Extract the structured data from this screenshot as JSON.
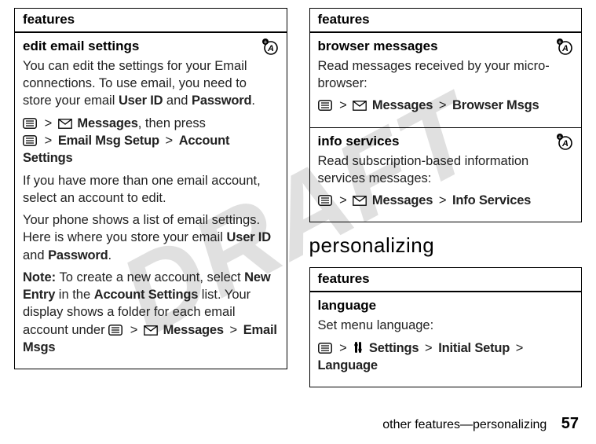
{
  "watermark": "DRAFT",
  "left": {
    "features_label": "features",
    "edit_email": {
      "title": "edit email settings",
      "p1a": "You can edit the settings for your Email connections. To use email, you need to store your email ",
      "userid": "User ID",
      "and1": " and ",
      "password": "Password",
      "p1b": ".",
      "path1_messages": "Messages",
      "path1_tail": ", then press",
      "path2_a": "Email Msg Setup",
      "path2_b": "Account Settings",
      "p2": "If you have more than one email account, select an account to edit.",
      "p3a": "Your phone shows a list of email settings. Here is where you store your email ",
      "p3b": ".",
      "note_label": "Note:",
      "note_a": " To create a new account, select ",
      "new_entry": "New Entry",
      "note_b": " in the ",
      "account_settings": "Account Settings",
      "note_c": " list. Your display shows a folder for each email account under ",
      "path3_messages": "Messages",
      "path3_email_msgs": "Email Msgs"
    }
  },
  "right": {
    "features_label": "features",
    "browser": {
      "title": "browser messages",
      "p": "Read messages received by your micro-browser:",
      "messages": "Messages",
      "browser_msgs": "Browser Msgs"
    },
    "info": {
      "title": "info services",
      "p": "Read subscription-based information services messages:",
      "messages": "Messages",
      "info_services": "Info Services"
    },
    "personalizing_heading": "personalizing",
    "features_label2": "features",
    "language": {
      "title": "language",
      "p": "Set menu language:",
      "settings": "Settings",
      "initial_setup": "Initial Setup",
      "language": "Language"
    }
  },
  "footer": {
    "text": "other features—personalizing",
    "page": "57"
  }
}
